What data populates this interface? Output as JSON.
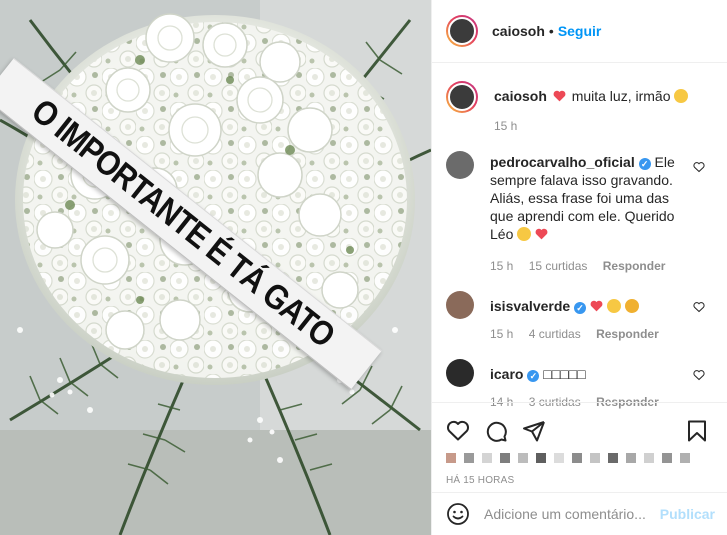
{
  "header": {
    "username": "caiosoh",
    "separator": "•",
    "follow_label": "Seguir"
  },
  "photo": {
    "ribbon_text": "O IMPORTANTE É TÁ GATO"
  },
  "caption": {
    "username": "caiosoh",
    "text": "muita luz, irmão",
    "time": "15 h"
  },
  "comments": [
    {
      "username": "pedrocarvalho_oficial",
      "verified": true,
      "text": "Ele sempre falava isso gravando. Aliás, essa frase foi uma das que aprendi com ele. Querido Léo",
      "time": "15 h",
      "likes": "15 curtidas",
      "reply": "Responder"
    },
    {
      "username": "isisvalverde",
      "verified": true,
      "text": "",
      "time": "15 h",
      "likes": "4 curtidas",
      "reply": "Responder"
    },
    {
      "username": "icaro",
      "verified": true,
      "text": "□□□□□",
      "time": "14 h",
      "likes": "3 curtidas",
      "reply": "Responder"
    }
  ],
  "actions": {
    "timestamp": "HÁ 15 HORAS"
  },
  "add_comment": {
    "placeholder": "Adicione um comentário...",
    "post_label": "Publicar"
  },
  "colors": {
    "accent": "#0095f6",
    "heart": "#ed4956",
    "verified": "#3897f0",
    "muted": "#8e8e8e"
  },
  "icons": [
    "heart-icon",
    "comment-icon",
    "share-icon",
    "bookmark-icon",
    "smile-icon"
  ]
}
